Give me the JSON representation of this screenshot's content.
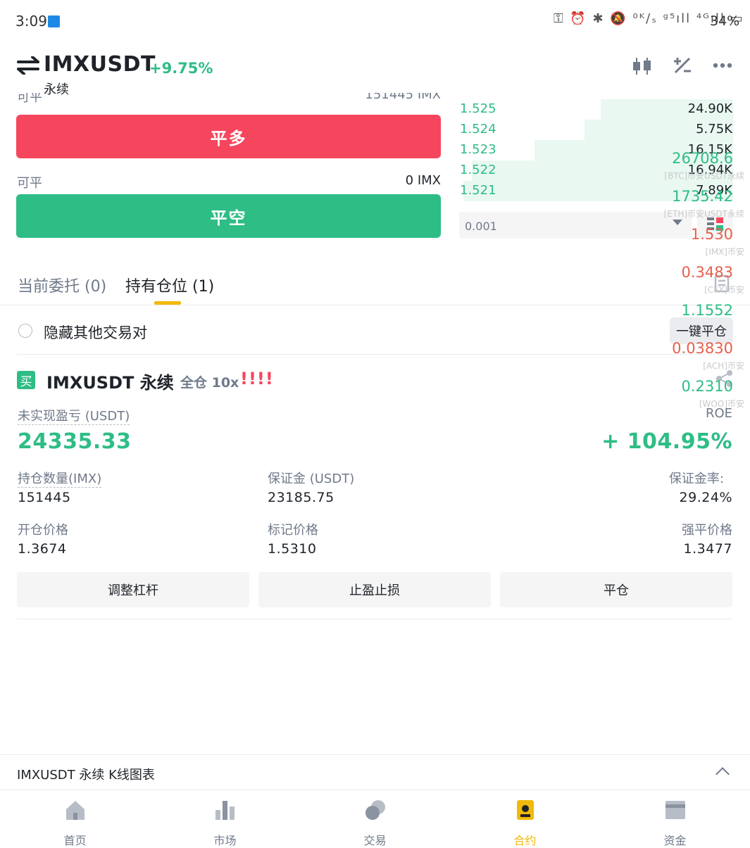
{
  "status_bar": {
    "time": "3:09",
    "icons": "⚿ ⏰ ✱ 🔕 ⁰ᴷ/ₛ ᵍ⁵ıll ⁴ᴳıll ▭",
    "battery": "34%"
  },
  "header": {
    "pair": "IMXUSDT",
    "change": "+9.75%",
    "subtitle": "永续"
  },
  "order_panel": {
    "cut_label": "可平",
    "cut_value": "151445 IMX",
    "close_long": "平多",
    "avail_label": "可平",
    "avail_value": "0 IMX",
    "close_short": "平空"
  },
  "order_book": [
    {
      "price": "1.525",
      "qty": "24.90K",
      "depth": 0.48
    },
    {
      "price": "1.524",
      "qty": "5.75K",
      "depth": 0.54
    },
    {
      "price": "1.523",
      "qty": "16.15K",
      "depth": 0.72
    },
    {
      "price": "1.522",
      "qty": "16.94K",
      "depth": 0.95
    },
    {
      "price": "1.521",
      "qty": "7.89K",
      "depth": 0.98
    }
  ],
  "precision": {
    "value": "0.001"
  },
  "tabs": {
    "open_orders": "当前委托 (0)",
    "positions": "持有仓位 (1)"
  },
  "filter": {
    "hide_others": "隐藏其他交易对",
    "close_all": "一键平仓"
  },
  "position": {
    "side_badge": "买",
    "title": "IMXUSDT 永续",
    "mode": "全仓 10x",
    "warning": "!!!!",
    "pnl_label": "未实现盈亏 (USDT)",
    "pnl_value": "24335.33",
    "roe_label": "ROE",
    "roe_value": "+ 104.95%",
    "size_label": "持仓数量(IMX)",
    "size_value": "151445",
    "margin_label": "保证金 (USDT)",
    "margin_value": "23185.75",
    "margin_ratio_label": "保证金率:",
    "margin_ratio_value": "29.24%",
    "entry_label": "开仓价格",
    "entry_value": "1.3674",
    "mark_label": "标记价格",
    "mark_value": "1.5310",
    "liq_label": "强平价格",
    "liq_value": "1.3477",
    "btn_leverage": "调整杠杆",
    "btn_tpsl": "止盈止损",
    "btn_close": "平仓"
  },
  "ticker_overlay": [
    {
      "price": "26708.6",
      "label": "[BTC]币安USDT永续",
      "color": "green"
    },
    {
      "price": "1735.42",
      "label": "[ETH]币安USDT永续",
      "color": "green"
    },
    {
      "price": "1.530",
      "label": "[IMX]币安",
      "color": "red"
    },
    {
      "price": "0.3483",
      "label": "[CFX]币安",
      "color": "red"
    },
    {
      "price": "1.1552",
      "label": "",
      "color": "green"
    },
    {
      "price": "0.03830",
      "label": "[ACH]币安",
      "color": "red"
    },
    {
      "price": "0.2310",
      "label": "[WOO]币安",
      "color": "green"
    }
  ],
  "kline": {
    "label": "IMXUSDT 永续  K线图表"
  },
  "bottom_nav": [
    {
      "label": "首页",
      "icon": "home-icon",
      "active": false
    },
    {
      "label": "市场",
      "icon": "market-icon",
      "active": false
    },
    {
      "label": "交易",
      "icon": "trade-icon",
      "active": false
    },
    {
      "label": "合约",
      "icon": "futures-icon",
      "active": true
    },
    {
      "label": "资金",
      "icon": "wallet-icon",
      "active": false
    }
  ],
  "colors": {
    "buy": "#2ebd85",
    "sell": "#f6465d",
    "accent": "#f0b90b"
  }
}
